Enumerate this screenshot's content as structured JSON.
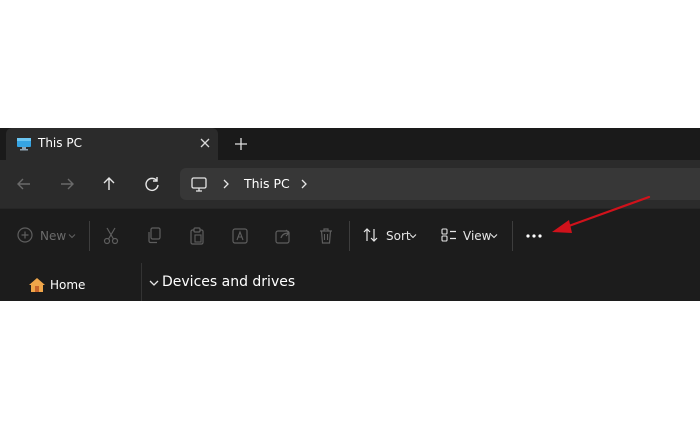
{
  "tab": {
    "title": "This PC",
    "close_icon": "close-icon",
    "new_tab_icon": "plus-icon"
  },
  "nav": {
    "back_icon": "arrow-left-icon",
    "forward_icon": "arrow-right-icon",
    "up_icon": "arrow-up-icon",
    "refresh_icon": "refresh-icon"
  },
  "address": {
    "location_icon": "monitor-icon",
    "crumb": "This PC"
  },
  "toolbar": {
    "new_label": "New",
    "sort_label": "Sort",
    "view_label": "View",
    "more_icon": "more-ellipsis-icon"
  },
  "navpane": {
    "home_label": "Home"
  },
  "content": {
    "section_title": "Devices and drives"
  },
  "colors": {
    "annotation_arrow": "#d0121b",
    "dim_icon": "#5e5e5e",
    "accent_icon": "#3aa0e0"
  }
}
